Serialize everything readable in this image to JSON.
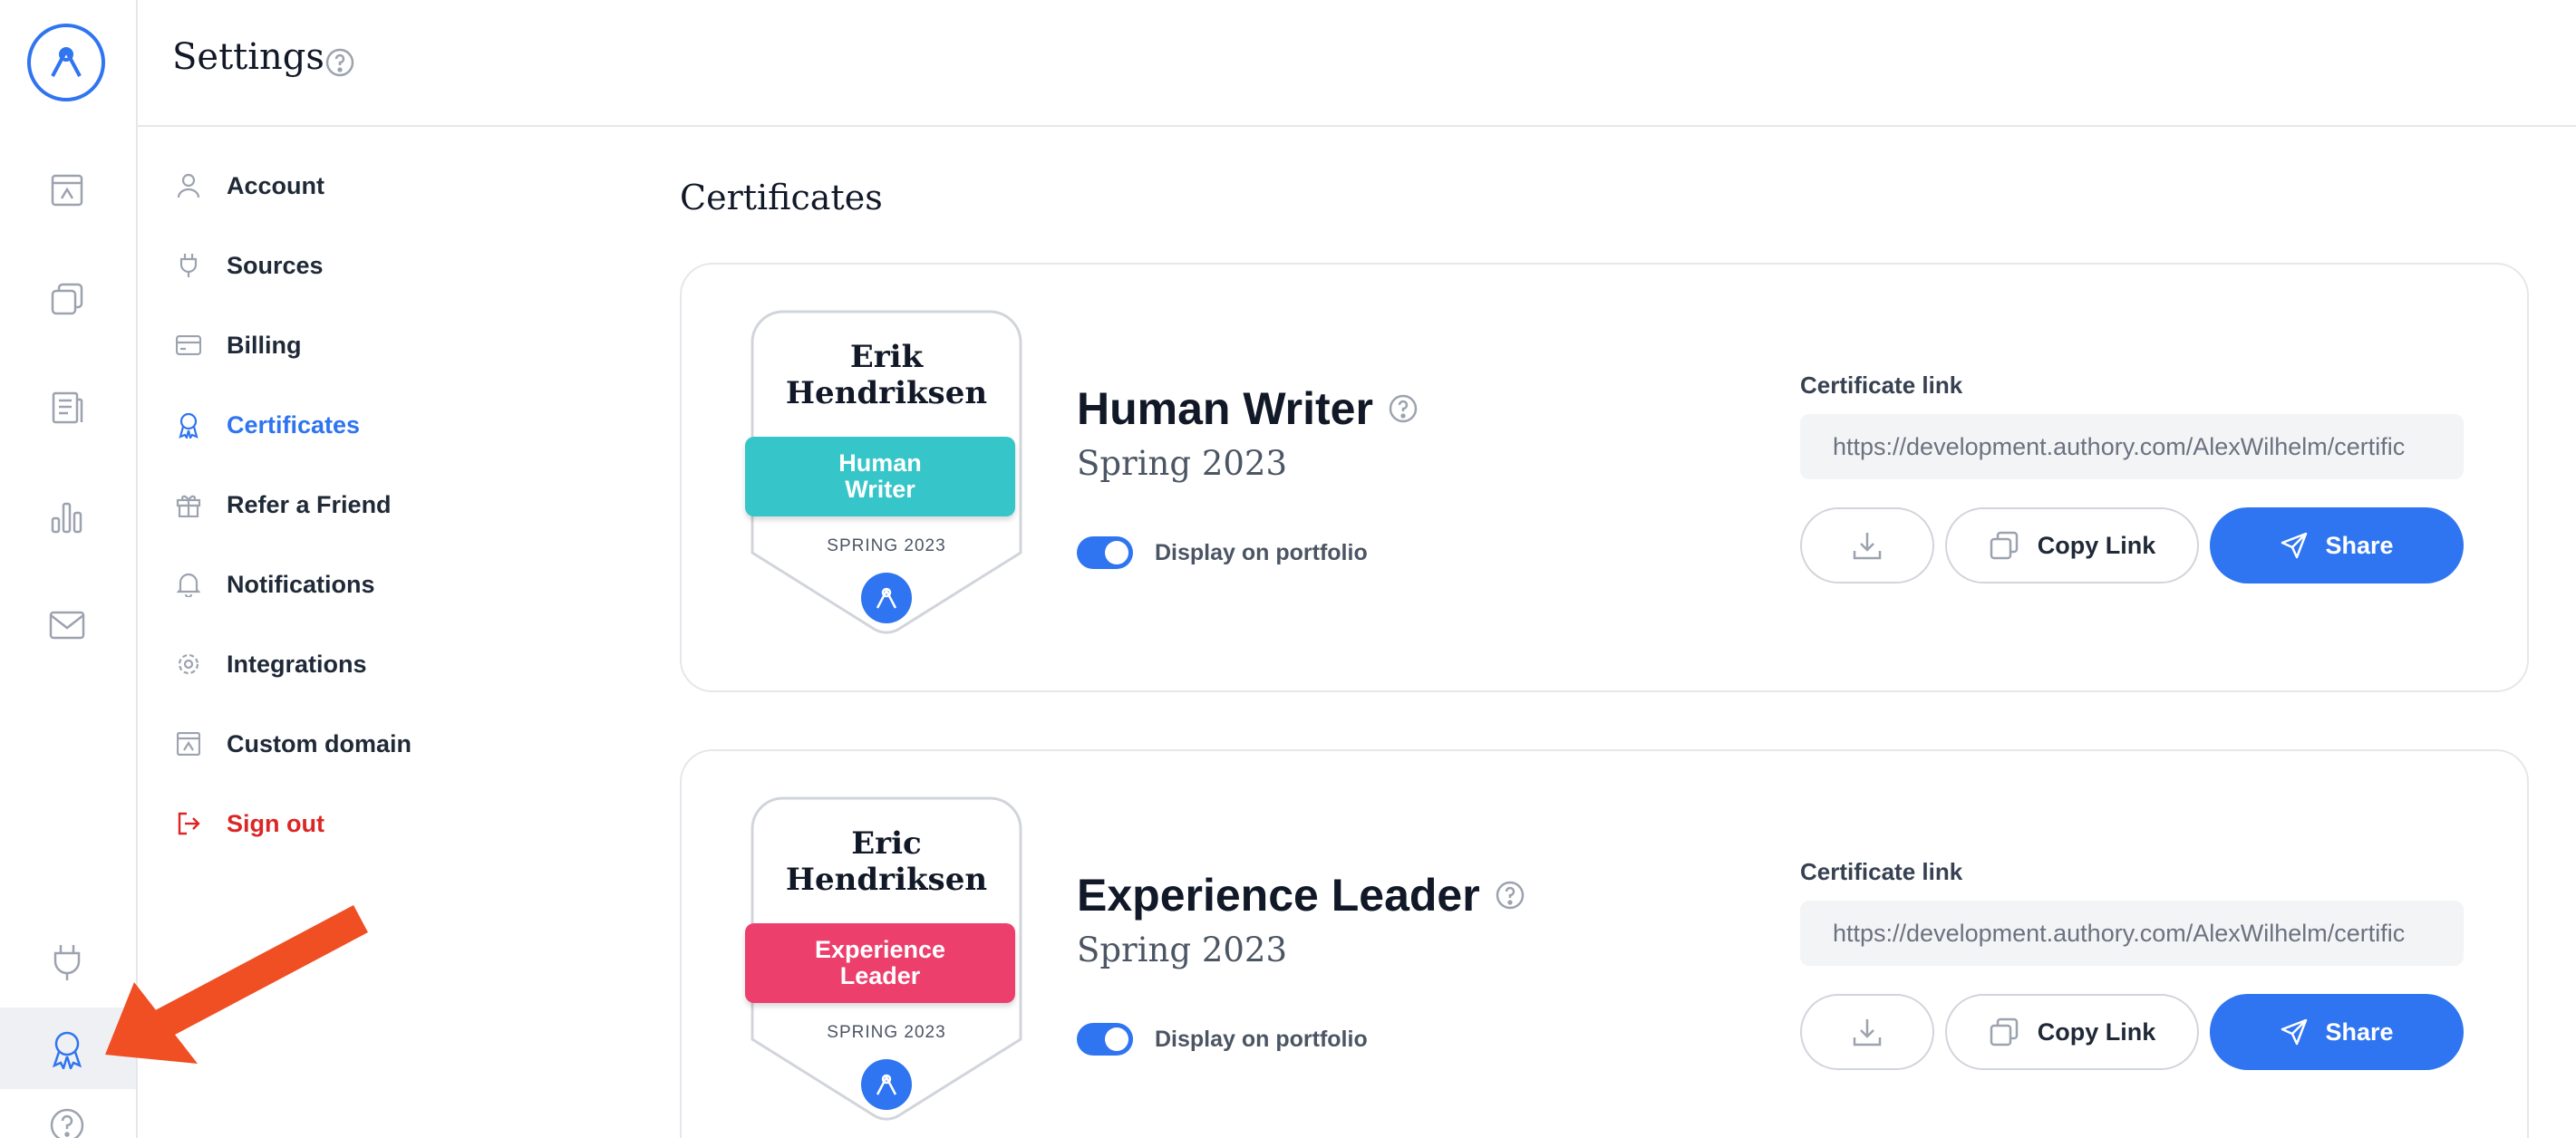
{
  "header": {
    "title": "Settings"
  },
  "nav": {
    "items": [
      {
        "label": "Account",
        "icon": "user-icon"
      },
      {
        "label": "Sources",
        "icon": "plug-icon"
      },
      {
        "label": "Billing",
        "icon": "credit-card-icon"
      },
      {
        "label": "Certificates",
        "icon": "award-icon",
        "active": true
      },
      {
        "label": "Refer a Friend",
        "icon": "gift-icon"
      },
      {
        "label": "Notifications",
        "icon": "bell-icon"
      },
      {
        "label": "Integrations",
        "icon": "gear-icon"
      },
      {
        "label": "Custom domain",
        "icon": "browser-icon"
      },
      {
        "label": "Sign out",
        "icon": "sign-out-icon"
      }
    ]
  },
  "main": {
    "section_title": "Certificates",
    "certificates": [
      {
        "badge_name": "Erik Hendriksen",
        "badge_ribbon": "Human Writer",
        "badge_season": "SPRING 2023",
        "ribbon_color": "#36c5c8",
        "title": "Human Writer",
        "season": "Spring 2023",
        "display_label": "Display on portfolio",
        "display_on": true,
        "link_label": "Certificate link",
        "link_value": "https://development.authory.com/AlexWilhelm/certific",
        "copy_label": "Copy Link",
        "share_label": "Share"
      },
      {
        "badge_name": "Eric Hendriksen",
        "badge_ribbon": "Experience Leader",
        "badge_season": "SPRING 2023",
        "ribbon_color": "#ec3f6c",
        "title": "Experience Leader",
        "season": "Spring 2023",
        "display_label": "Display on portfolio",
        "display_on": true,
        "link_label": "Certificate link",
        "link_value": "https://development.authory.com/AlexWilhelm/certific",
        "copy_label": "Copy Link",
        "share_label": "Share"
      }
    ]
  },
  "colors": {
    "accent": "#2f74f0",
    "danger": "#dc2626",
    "annotation_arrow": "#f04e23"
  }
}
